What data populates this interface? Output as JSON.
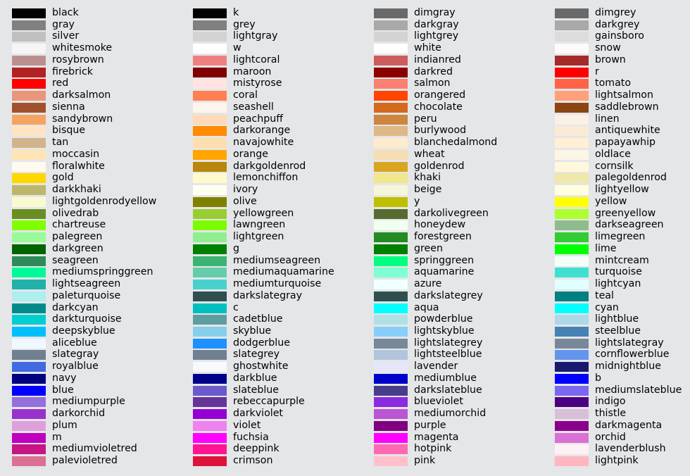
{
  "columns": [
    [
      {
        "name": "black",
        "hex": "#000000"
      },
      {
        "name": "gray",
        "hex": "#808080"
      },
      {
        "name": "silver",
        "hex": "#C0C0C0"
      },
      {
        "name": "whitesmoke",
        "hex": "#F5F5F5"
      },
      {
        "name": "rosybrown",
        "hex": "#BC8F8F"
      },
      {
        "name": "firebrick",
        "hex": "#B22222"
      },
      {
        "name": "red",
        "hex": "#FF0000"
      },
      {
        "name": "darksalmon",
        "hex": "#E9967A"
      },
      {
        "name": "sienna",
        "hex": "#A0522D"
      },
      {
        "name": "sandybrown",
        "hex": "#F4A460"
      },
      {
        "name": "bisque",
        "hex": "#FFE4C4"
      },
      {
        "name": "tan",
        "hex": "#D2B48C"
      },
      {
        "name": "moccasin",
        "hex": "#FFE4B5"
      },
      {
        "name": "floralwhite",
        "hex": "#FFFAF0"
      },
      {
        "name": "gold",
        "hex": "#FFD700"
      },
      {
        "name": "darkkhaki",
        "hex": "#BDB76B"
      },
      {
        "name": "lightgoldenrodyellow",
        "hex": "#FAFAD2"
      },
      {
        "name": "olivedrab",
        "hex": "#6B8E23"
      },
      {
        "name": "chartreuse",
        "hex": "#7FFF00"
      },
      {
        "name": "palegreen",
        "hex": "#98FB98"
      },
      {
        "name": "darkgreen",
        "hex": "#006400"
      },
      {
        "name": "seagreen",
        "hex": "#2E8B57"
      },
      {
        "name": "mediumspringgreen",
        "hex": "#00FA9A"
      },
      {
        "name": "lightseagreen",
        "hex": "#20B2AA"
      },
      {
        "name": "paleturquoise",
        "hex": "#AFEEEE"
      },
      {
        "name": "darkcyan",
        "hex": "#008B8B"
      },
      {
        "name": "darkturquoise",
        "hex": "#00CED1"
      },
      {
        "name": "deepskyblue",
        "hex": "#00BFFF"
      },
      {
        "name": "aliceblue",
        "hex": "#F0F8FF"
      },
      {
        "name": "slategray",
        "hex": "#708090"
      },
      {
        "name": "royalblue",
        "hex": "#4169E1"
      },
      {
        "name": "navy",
        "hex": "#000080"
      },
      {
        "name": "blue",
        "hex": "#0000FF"
      },
      {
        "name": "mediumpurple",
        "hex": "#9370DB"
      },
      {
        "name": "darkorchid",
        "hex": "#9932CC"
      },
      {
        "name": "plum",
        "hex": "#DDA0DD"
      },
      {
        "name": "m",
        "hex": "#BF00BF"
      },
      {
        "name": "mediumvioletred",
        "hex": "#C71585"
      },
      {
        "name": "palevioletred",
        "hex": "#DB7093"
      }
    ],
    [
      {
        "name": "k",
        "hex": "#000000"
      },
      {
        "name": "grey",
        "hex": "#808080"
      },
      {
        "name": "lightgray",
        "hex": "#D3D3D3"
      },
      {
        "name": "w",
        "hex": "#FFFFFF"
      },
      {
        "name": "lightcoral",
        "hex": "#F08080"
      },
      {
        "name": "maroon",
        "hex": "#800000"
      },
      {
        "name": "mistyrose",
        "hex": "#FFE4E1"
      },
      {
        "name": "coral",
        "hex": "#FF7F50"
      },
      {
        "name": "seashell",
        "hex": "#FFF5EE"
      },
      {
        "name": "peachpuff",
        "hex": "#FFDAB9"
      },
      {
        "name": "darkorange",
        "hex": "#FF8C00"
      },
      {
        "name": "navajowhite",
        "hex": "#FFDEAD"
      },
      {
        "name": "orange",
        "hex": "#FFA500"
      },
      {
        "name": "darkgoldenrod",
        "hex": "#B8860B"
      },
      {
        "name": "lemonchiffon",
        "hex": "#FFFACD"
      },
      {
        "name": "ivory",
        "hex": "#FFFFF0"
      },
      {
        "name": "olive",
        "hex": "#808000"
      },
      {
        "name": "yellowgreen",
        "hex": "#9ACD32"
      },
      {
        "name": "lawngreen",
        "hex": "#7CFC00"
      },
      {
        "name": "lightgreen",
        "hex": "#90EE90"
      },
      {
        "name": "g",
        "hex": "#008000"
      },
      {
        "name": "mediumseagreen",
        "hex": "#3CB371"
      },
      {
        "name": "mediumaquamarine",
        "hex": "#66CDAA"
      },
      {
        "name": "mediumturquoise",
        "hex": "#48D1CC"
      },
      {
        "name": "darkslategray",
        "hex": "#2F4F4F"
      },
      {
        "name": "c",
        "hex": "#00BFBF"
      },
      {
        "name": "cadetblue",
        "hex": "#5F9EA0"
      },
      {
        "name": "skyblue",
        "hex": "#87CEEB"
      },
      {
        "name": "dodgerblue",
        "hex": "#1E90FF"
      },
      {
        "name": "slategrey",
        "hex": "#708090"
      },
      {
        "name": "ghostwhite",
        "hex": "#F8F8FF"
      },
      {
        "name": "darkblue",
        "hex": "#00008B"
      },
      {
        "name": "slateblue",
        "hex": "#6A5ACD"
      },
      {
        "name": "rebeccapurple",
        "hex": "#663399"
      },
      {
        "name": "darkviolet",
        "hex": "#9400D3"
      },
      {
        "name": "violet",
        "hex": "#EE82EE"
      },
      {
        "name": "fuchsia",
        "hex": "#FF00FF"
      },
      {
        "name": "deeppink",
        "hex": "#FF1493"
      },
      {
        "name": "crimson",
        "hex": "#DC143C"
      }
    ],
    [
      {
        "name": "dimgray",
        "hex": "#696969"
      },
      {
        "name": "darkgray",
        "hex": "#A9A9A9"
      },
      {
        "name": "lightgrey",
        "hex": "#D3D3D3"
      },
      {
        "name": "white",
        "hex": "#FFFFFF"
      },
      {
        "name": "indianred",
        "hex": "#CD5C5C"
      },
      {
        "name": "darkred",
        "hex": "#8B0000"
      },
      {
        "name": "salmon",
        "hex": "#FA8072"
      },
      {
        "name": "orangered",
        "hex": "#FF4500"
      },
      {
        "name": "chocolate",
        "hex": "#D2691E"
      },
      {
        "name": "peru",
        "hex": "#CD853F"
      },
      {
        "name": "burlywood",
        "hex": "#DEB887"
      },
      {
        "name": "blanchedalmond",
        "hex": "#FFEBCD"
      },
      {
        "name": "wheat",
        "hex": "#F5DEB3"
      },
      {
        "name": "goldenrod",
        "hex": "#DAA520"
      },
      {
        "name": "khaki",
        "hex": "#F0E68C"
      },
      {
        "name": "beige",
        "hex": "#F5F5DC"
      },
      {
        "name": "y",
        "hex": "#BFBF00"
      },
      {
        "name": "darkolivegreen",
        "hex": "#556B2F"
      },
      {
        "name": "honeydew",
        "hex": "#F0FFF0"
      },
      {
        "name": "forestgreen",
        "hex": "#228B22"
      },
      {
        "name": "green",
        "hex": "#008000"
      },
      {
        "name": "springgreen",
        "hex": "#00FF7F"
      },
      {
        "name": "aquamarine",
        "hex": "#7FFFD4"
      },
      {
        "name": "azure",
        "hex": "#F0FFFF"
      },
      {
        "name": "darkslategrey",
        "hex": "#2F4F4F"
      },
      {
        "name": "aqua",
        "hex": "#00FFFF"
      },
      {
        "name": "powderblue",
        "hex": "#B0E0E6"
      },
      {
        "name": "lightskyblue",
        "hex": "#87CEFA"
      },
      {
        "name": "lightslategrey",
        "hex": "#778899"
      },
      {
        "name": "lightsteelblue",
        "hex": "#B0C4DE"
      },
      {
        "name": "lavender",
        "hex": "#E6E6FA"
      },
      {
        "name": "mediumblue",
        "hex": "#0000CD"
      },
      {
        "name": "darkslateblue",
        "hex": "#483D8B"
      },
      {
        "name": "blueviolet",
        "hex": "#8A2BE2"
      },
      {
        "name": "mediumorchid",
        "hex": "#BA55D3"
      },
      {
        "name": "purple",
        "hex": "#800080"
      },
      {
        "name": "magenta",
        "hex": "#FF00FF"
      },
      {
        "name": "hotpink",
        "hex": "#FF69B4"
      },
      {
        "name": "pink",
        "hex": "#FFC0CB"
      }
    ],
    [
      {
        "name": "dimgrey",
        "hex": "#696969"
      },
      {
        "name": "darkgrey",
        "hex": "#A9A9A9"
      },
      {
        "name": "gainsboro",
        "hex": "#DCDCDC"
      },
      {
        "name": "snow",
        "hex": "#FFFAFA"
      },
      {
        "name": "brown",
        "hex": "#A52A2A"
      },
      {
        "name": "r",
        "hex": "#FF0000"
      },
      {
        "name": "tomato",
        "hex": "#FF6347"
      },
      {
        "name": "lightsalmon",
        "hex": "#FFA07A"
      },
      {
        "name": "saddlebrown",
        "hex": "#8B4513"
      },
      {
        "name": "linen",
        "hex": "#FAF0E6"
      },
      {
        "name": "antiquewhite",
        "hex": "#FAEBD7"
      },
      {
        "name": "papayawhip",
        "hex": "#FFEFD5"
      },
      {
        "name": "oldlace",
        "hex": "#FDF5E6"
      },
      {
        "name": "cornsilk",
        "hex": "#FFF8DC"
      },
      {
        "name": "palegoldenrod",
        "hex": "#EEE8AA"
      },
      {
        "name": "lightyellow",
        "hex": "#FFFFE0"
      },
      {
        "name": "yellow",
        "hex": "#FFFF00"
      },
      {
        "name": "greenyellow",
        "hex": "#ADFF2F"
      },
      {
        "name": "darkseagreen",
        "hex": "#8FBC8F"
      },
      {
        "name": "limegreen",
        "hex": "#32CD32"
      },
      {
        "name": "lime",
        "hex": "#00FF00"
      },
      {
        "name": "mintcream",
        "hex": "#F5FFFA"
      },
      {
        "name": "turquoise",
        "hex": "#40E0D0"
      },
      {
        "name": "lightcyan",
        "hex": "#E0FFFF"
      },
      {
        "name": "teal",
        "hex": "#008080"
      },
      {
        "name": "cyan",
        "hex": "#00FFFF"
      },
      {
        "name": "lightblue",
        "hex": "#ADD8E6"
      },
      {
        "name": "steelblue",
        "hex": "#4682B4"
      },
      {
        "name": "lightslategray",
        "hex": "#778899"
      },
      {
        "name": "cornflowerblue",
        "hex": "#6495ED"
      },
      {
        "name": "midnightblue",
        "hex": "#191970"
      },
      {
        "name": "b",
        "hex": "#0000FF"
      },
      {
        "name": "mediumslateblue",
        "hex": "#7B68EE"
      },
      {
        "name": "indigo",
        "hex": "#4B0082"
      },
      {
        "name": "thistle",
        "hex": "#D8BFD8"
      },
      {
        "name": "darkmagenta",
        "hex": "#8B008B"
      },
      {
        "name": "orchid",
        "hex": "#DA70D6"
      },
      {
        "name": "lavenderblush",
        "hex": "#FFF0F5"
      },
      {
        "name": "lightpink",
        "hex": "#FFB6C1"
      }
    ]
  ]
}
